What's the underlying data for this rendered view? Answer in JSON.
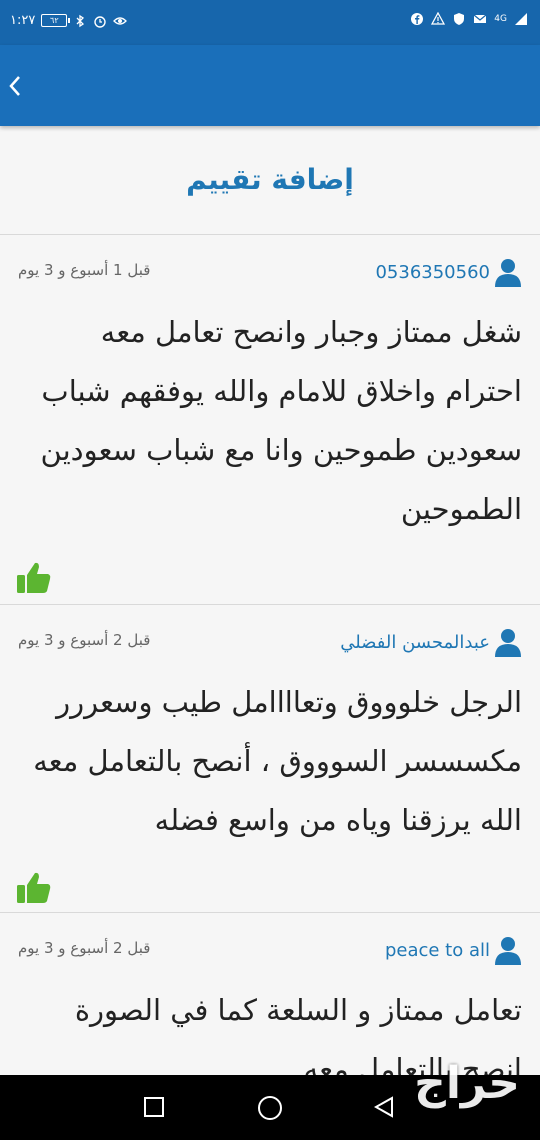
{
  "status_bar": {
    "time": "١:٢٧",
    "battery": "٦٢",
    "network": "4G"
  },
  "header": {
    "add_review_label": "إضافة تقييم"
  },
  "reviews": [
    {
      "user": "0536350560",
      "time": "قبل 1 أسبوع و 3 يوم",
      "text": "شغل ممتاز وجبار وانصح تعامل معه احترام واخلاق للامام والله يوفقهم شباب سعودين طموحين وانا مع شباب سعودين الطموحين"
    },
    {
      "user": "عبدالمحسن الفضلي",
      "time": "قبل 2 أسبوع و 3 يوم",
      "text": "الرجل خلوووق وتعاااامل طيب وسعررر مكسسسر السوووق ، أنصح بالتعامل معه الله يرزقنا وياه من واسع فضله"
    },
    {
      "user": "peace to all",
      "time": "قبل 2 أسبوع و 3 يوم",
      "text": "تعامل ممتاز و السلعة كما في الصورة انصح بالتعامل معه"
    }
  ],
  "watermark": "حراج",
  "colors": {
    "status_bar": "#1766ac",
    "app_bar": "#1a6fba",
    "link": "#1f77b4",
    "like": "#5cb531"
  }
}
